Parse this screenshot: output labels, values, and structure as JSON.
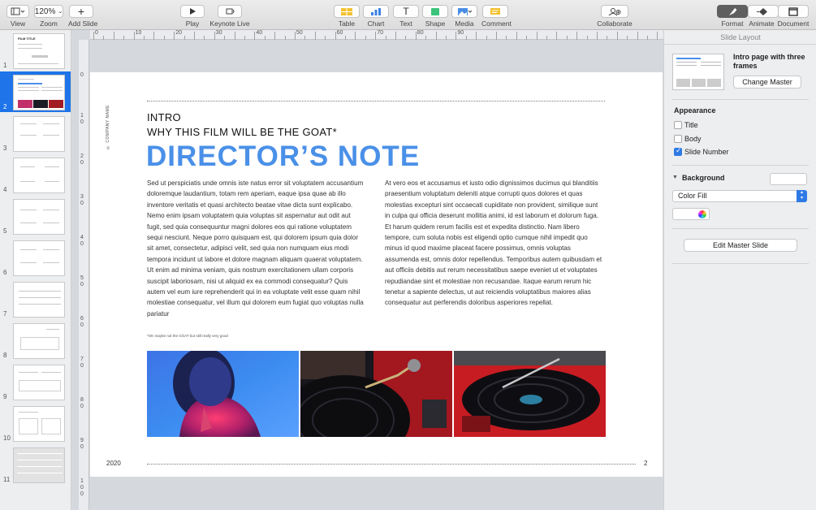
{
  "toolbar": {
    "view_label": "View",
    "zoom_label": "Zoom",
    "zoom_value": "120%",
    "add_slide_label": "Add Slide",
    "play_label": "Play",
    "keynote_live_label": "Keynote Live",
    "table_label": "Table",
    "chart_label": "Chart",
    "text_label": "Text",
    "shape_label": "Shape",
    "media_label": "Media",
    "comment_label": "Comment",
    "collaborate_label": "Collaborate",
    "format_label": "Format",
    "animate_label": "Animate",
    "document_label": "Document"
  },
  "navigator": {
    "slide_numbers": [
      "1",
      "2",
      "3",
      "4",
      "5",
      "6",
      "7",
      "8",
      "9",
      "10",
      "11"
    ],
    "selected": "2",
    "thumb1_title": "FILM TITLE"
  },
  "ruler": {
    "top": [
      "0",
      "10",
      "20",
      "30",
      "40",
      "50",
      "60",
      "70",
      "80",
      "90"
    ],
    "left": [
      "0",
      "1|0",
      "2|0",
      "3|0",
      "4|0",
      "5|0",
      "6|0",
      "7|0",
      "8|0",
      "9|0",
      "1|0|0"
    ]
  },
  "slide": {
    "company": "© COMPANY NAME",
    "intro_line1": "INTRO",
    "intro_line2": "WHY THIS FILM WILL BE THE GOAT*",
    "headline": "DIRECTOR’S NOTE",
    "col1": "Sed ut perspiciatis unde omnis iste natus error sit voluptatem accusantium doloremque laudantium, totam rem aperiam, eaque ipsa quae ab illo inventore veritatis et quasi architecto beatae vitae dicta sunt explicabo. Nemo enim ipsam voluptatem quia voluptas sit aspernatur aut odit aut fugit, sed quia consequuntur magni dolores eos qui ratione voluptatem sequi nesciunt. Neque porro quisquam est, qui dolorem ipsum quia dolor sit amet, consectetur, adipisci velit, sed quia non numquam eius modi tempora incidunt ut labore et dolore magnam aliquam quaerat voluptatem. Ut enim ad minima veniam, quis nostrum exercitationem ullam corporis suscipit laboriosam, nisi ut aliquid ex ea commodi consequatur? Quis autem vel eum iure reprehenderit qui in ea voluptate velit esse quam nihil molestiae consequatur, vel illum qui dolorem eum fugiat quo voluptas nulla pariatur",
    "col2": "At vero eos et accusamus et iusto odio dignissimos ducimus qui blanditiis praesentium voluptatum deleniti atque corrupti quos dolores et quas molestias excepturi sint occaecati cupiditate non provident, similique sunt in culpa qui officia deserunt mollitia animi, id est laborum et dolorum fuga. Et harum quidem rerum facilis est et expedita distinctio. Nam libero tempore, cum soluta nobis est eligendi optio cumque nihil impedit quo minus id quod maxime placeat facere possimus, omnis voluptas assumenda est, omnis dolor repellendus. Temporibus autem quibusdam et aut officiis debitis aut rerum necessitatibus saepe eveniet ut et voluptates repudiandae sint et molestiae non recusandae. Itaque earum rerum hic tenetur a sapiente delectus, ut aut reiciendis voluptatibus maiores alias consequatur aut perferendis doloribus asperiores repellat.",
    "footnote": "*OK maybe not the GOAT but still really very good",
    "year": "2020",
    "page_number": "2"
  },
  "panel": {
    "header": "Slide Layout",
    "master_name": "Intro page with three frames",
    "change_master": "Change Master",
    "appearance": "Appearance",
    "title_label": "Title",
    "body_label": "Body",
    "slide_number_label": "Slide Number",
    "title_checked": false,
    "body_checked": false,
    "slide_number_checked": true,
    "background": "Background",
    "fill_type": "Color Fill",
    "edit_master": "Edit Master Slide"
  },
  "colors": {
    "accent": "#4a90e8",
    "selection": "#1e74e8"
  }
}
